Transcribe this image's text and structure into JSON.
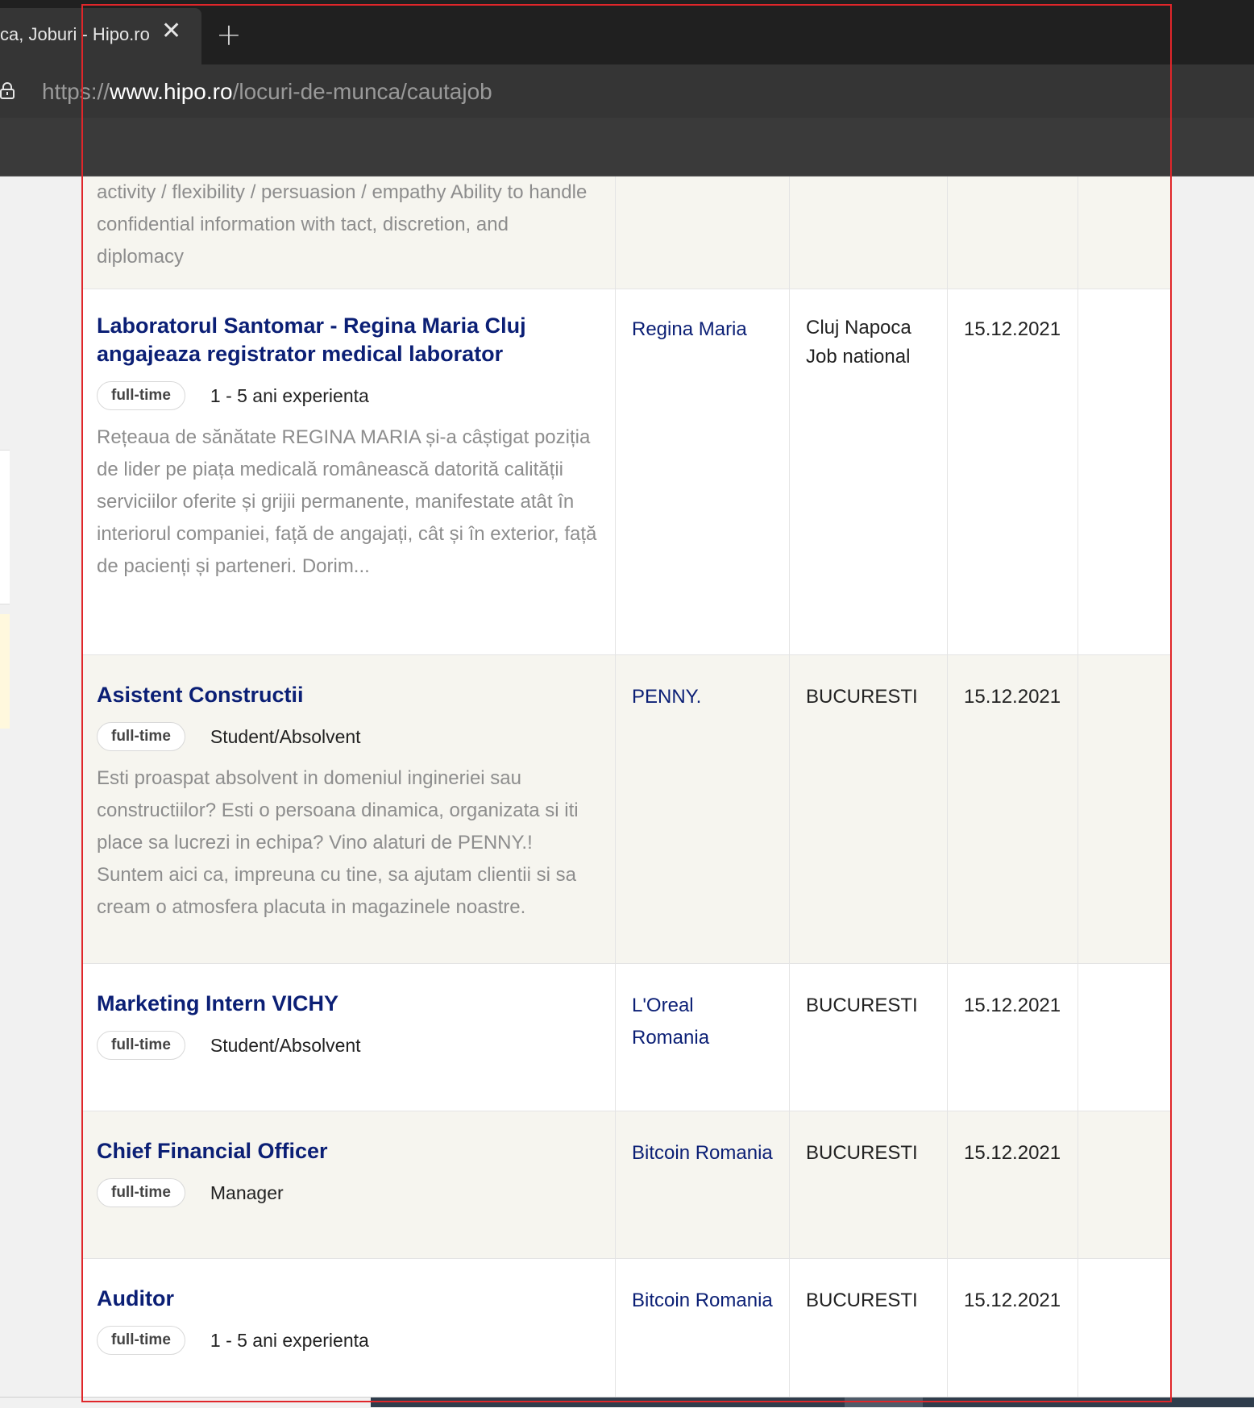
{
  "browser": {
    "tab_title": "ca, Joburi - Hipo.ro",
    "tab_close": "✕",
    "new_tab": "+",
    "url_scheme": "https://",
    "url_domain": "www.hipo.ro",
    "url_path": "/locuri-de-munca/cautajob"
  },
  "jobs": [
    {
      "description": "interpersonal, presentation and communication skills Pro-activity / flexibility / persuasion / empathy Ability to handle confidential information with tact, discretion, and diplomacy"
    },
    {
      "title": "Laboratorul Santomar - Regina Maria Cluj angajeaza registrator medical laborator",
      "type": "full-time",
      "experience": "1 - 5 ani experienta",
      "description": "Rețeaua de sănătate REGINA MARIA și-a câștigat poziția de lider pe piața medicală românească datorită calității serviciilor oferite și grijii permanente, manifestate atât în interiorul companiei, față de angajați, cât și în exterior, față de pacienți și parteneri. Dorim...",
      "company": "Regina Maria",
      "location": "Cluj Napoca",
      "location2": "Job national",
      "date": "15.12.2021"
    },
    {
      "title": "Asistent Constructii",
      "type": "full-time",
      "experience": "Student/Absolvent",
      "description": "Esti proaspat absolvent in domeniul ingineriei sau constructiilor? Esti o persoana dinamica, organizata si iti place sa lucrezi in echipa? Vino alaturi de PENNY.! Suntem aici ca, impreuna cu tine, sa ajutam clientii si sa cream o atmosfera placuta in magazinele noastre.",
      "company": "PENNY.",
      "location": "BUCURESTI",
      "date": "15.12.2021"
    },
    {
      "title": "Marketing Intern VICHY",
      "type": "full-time",
      "experience": "Student/Absolvent",
      "company": "L'Oreal Romania",
      "location": "BUCURESTI",
      "date": "15.12.2021"
    },
    {
      "title": "Chief Financial Officer",
      "type": "full-time",
      "experience": "Manager",
      "company": "Bitcoin Romania",
      "location": "BUCURESTI",
      "date": "15.12.2021"
    },
    {
      "title": "Auditor",
      "type": "full-time",
      "experience": "1 - 5 ani experienta",
      "company": "Bitcoin Romania",
      "location": "BUCURESTI",
      "date": "15.12.2021"
    }
  ]
}
